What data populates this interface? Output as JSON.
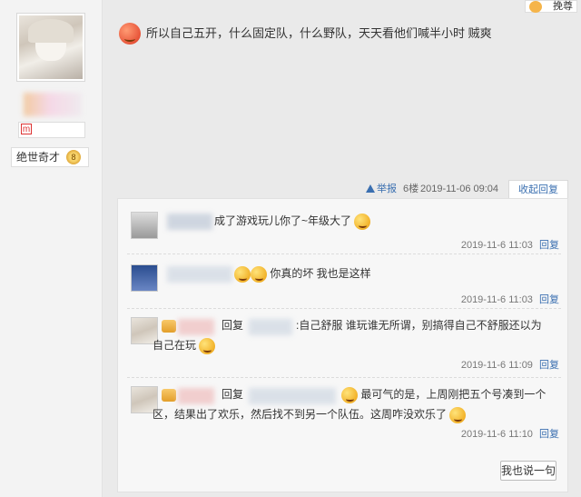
{
  "user": {
    "title": "绝世奇才",
    "title_level": "8",
    "level_icon": "M-level-icon"
  },
  "top_badge": {
    "label": "挽尊"
  },
  "post": {
    "text": "所以自己五开，什么固定队，什么野队，天天看他们喊半小时 贼爽"
  },
  "post_meta": {
    "report": "举报",
    "floor": "6楼",
    "date": "2019-11-06 09:04",
    "collapse": "收起回复"
  },
  "replies": [
    {
      "text": "成了游戏玩儿你了~年级大了",
      "date": "2019-11-6 11:03",
      "reply_label": "回复"
    },
    {
      "text": "你真的坏 我也是这样",
      "date": "2019-11-6 11:03",
      "reply_label": "回复"
    },
    {
      "prefix": "回复",
      "text_line1": ":自己舒服 谁玩谁无所谓，别搞得自己不舒服还以为",
      "text_line2": "自己在玩",
      "date": "2019-11-6 11:09",
      "reply_label": "回复"
    },
    {
      "prefix": "回复",
      "text_line1": "最可气的是，上周刚把五个号凑到一个",
      "text_line2": "区，结果出了欢乐，然后找不到另一个队伍。这周咋没欢乐了",
      "date": "2019-11-6 11:10",
      "reply_label": "回复"
    }
  ],
  "say_button": "我也说一句"
}
